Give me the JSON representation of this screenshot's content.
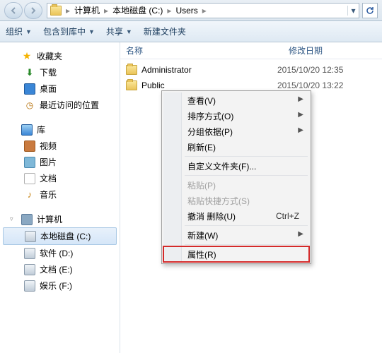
{
  "breadcrumb": {
    "root_icon": "folder-icon",
    "items": [
      "计算机",
      "本地磁盘 (C:)",
      "Users"
    ]
  },
  "toolbar": {
    "organize": "组织",
    "include": "包含到库中",
    "share": "共享",
    "newfolder": "新建文件夹"
  },
  "sidebar": {
    "favorites": {
      "label": "收藏夹",
      "items": [
        {
          "label": "下载",
          "icon": "download-icon"
        },
        {
          "label": "桌面",
          "icon": "desktop-icon"
        },
        {
          "label": "最近访问的位置",
          "icon": "recent-icon"
        }
      ]
    },
    "libraries": {
      "label": "库",
      "items": [
        {
          "label": "视频",
          "icon": "video-icon"
        },
        {
          "label": "图片",
          "icon": "picture-icon"
        },
        {
          "label": "文档",
          "icon": "document-icon"
        },
        {
          "label": "音乐",
          "icon": "music-icon"
        }
      ]
    },
    "computer": {
      "label": "计算机",
      "items": [
        {
          "label": "本地磁盘 (C:)",
          "icon": "drive-icon",
          "selected": true
        },
        {
          "label": "软件 (D:)",
          "icon": "drive-icon"
        },
        {
          "label": "文档 (E:)",
          "icon": "drive-icon"
        },
        {
          "label": "娱乐 (F:)",
          "icon": "drive-icon"
        }
      ]
    }
  },
  "columns": {
    "name": "名称",
    "date": "修改日期"
  },
  "files": [
    {
      "name": "Administrator",
      "date": "2015/10/20 12:35"
    },
    {
      "name": "Public",
      "date": "2015/10/20 13:22"
    }
  ],
  "context_menu": [
    {
      "label": "查看(V)",
      "submenu": true
    },
    {
      "label": "排序方式(O)",
      "submenu": true
    },
    {
      "label": "分组依据(P)",
      "submenu": true
    },
    {
      "label": "刷新(E)"
    },
    {
      "sep": true
    },
    {
      "label": "自定义文件夹(F)..."
    },
    {
      "sep": true
    },
    {
      "label": "粘贴(P)",
      "disabled": true
    },
    {
      "label": "粘贴快捷方式(S)",
      "disabled": true
    },
    {
      "label": "撤消 删除(U)",
      "shortcut": "Ctrl+Z"
    },
    {
      "sep": true
    },
    {
      "label": "新建(W)",
      "submenu": true
    },
    {
      "sep": true
    },
    {
      "label": "属性(R)",
      "highlighted": true
    }
  ]
}
